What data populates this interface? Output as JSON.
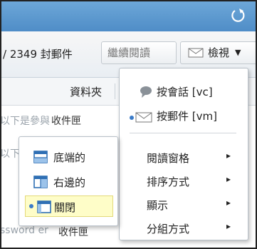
{
  "toolbar": {
    "message_count": "/ 2349 封郵件",
    "continue_reading": "繼續閱讀",
    "view_label": "檢視"
  },
  "list": {
    "folder_column": "資料夾",
    "rows": [
      {
        "prefix": "以下是參與",
        "folder": "收件匣"
      },
      {
        "prefix": "以下",
        "folder": ""
      },
      {
        "prefix": "ssword er",
        "folder": "收件匣"
      }
    ]
  },
  "view_menu": {
    "by_conversation": "按會話 [vc]",
    "by_message": "按郵件 [vm]",
    "reading_pane": "閱讀窗格",
    "sort_by": "排序方式",
    "show": "顯示",
    "group_by": "分組方式",
    "arrow": "▸"
  },
  "reading_pane_menu": {
    "bottom": "底端的",
    "right": "右邊的",
    "off": "關閉"
  },
  "icons": {
    "refresh": "refresh-icon",
    "envelope": "envelope-icon",
    "conversation": "speech-bubble-icon",
    "pane_bottom": "pane-bottom-icon",
    "pane_right": "pane-right-icon",
    "pane_off": "pane-off-icon"
  },
  "colors": {
    "titlebar": "#5b97cf",
    "accent": "#3a7bc8",
    "highlight": "#fefdc8"
  }
}
